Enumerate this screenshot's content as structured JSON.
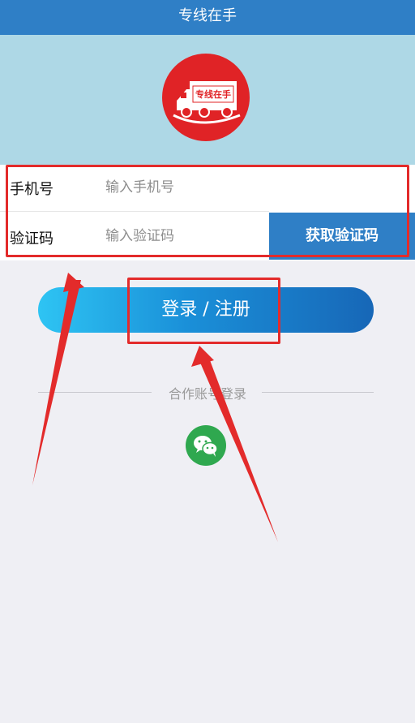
{
  "app": {
    "title": "专线在手"
  },
  "logo": {
    "text": "专线在手",
    "bg_color": "#e02326"
  },
  "form": {
    "phone_label": "手机号",
    "phone_placeholder": "输入手机号",
    "code_label": "验证码",
    "code_placeholder": "输入验证码",
    "get_code_button": "获取验证码"
  },
  "login": {
    "button_label": "登录 / 注册"
  },
  "third_party": {
    "divider_text": "合作账号登录",
    "wechat_icon": "wechat-icon"
  },
  "colors": {
    "primary": "#2f7fc6",
    "header_bg": "#aed8e6",
    "annotation": "#e32b2b",
    "wechat": "#2fa84f"
  }
}
